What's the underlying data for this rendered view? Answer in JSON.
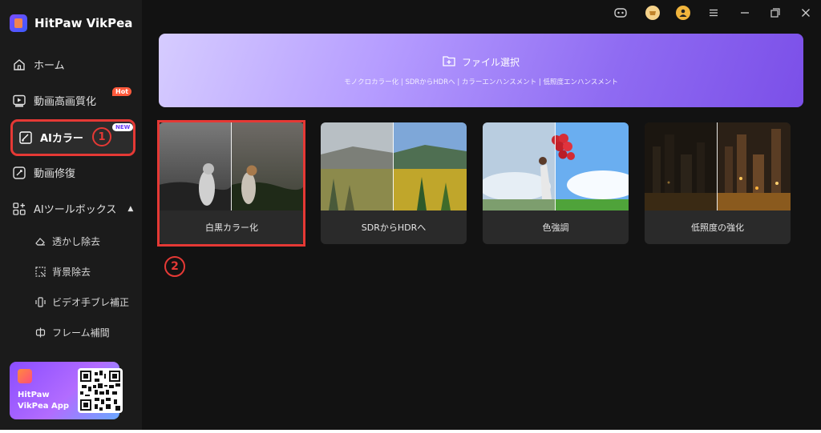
{
  "app": {
    "name": "HitPaw VikPea"
  },
  "sidebar": {
    "items": [
      {
        "label": "ホーム",
        "icon": "home-icon"
      },
      {
        "label": "動画高画質化",
        "icon": "video-enhance-icon",
        "badge": "Hot"
      },
      {
        "label": "AIカラー",
        "icon": "ai-color-icon",
        "badge": "NEW",
        "active": true
      },
      {
        "label": "動画修復",
        "icon": "repair-icon"
      },
      {
        "label": "AIツールボックス",
        "icon": "toolbox-icon"
      }
    ],
    "subitems": [
      {
        "label": "透かし除去",
        "icon": "eraser-icon"
      },
      {
        "label": "背景除去",
        "icon": "background-remove-icon"
      },
      {
        "label": "ビデオ手ブレ補正",
        "icon": "stabilize-icon"
      },
      {
        "label": "フレーム補間",
        "icon": "frame-interpolation-icon"
      }
    ],
    "app_card": {
      "line1": "HitPaw",
      "line2": "VikPea App"
    }
  },
  "annotations": {
    "step1": "1",
    "step2": "2"
  },
  "banner": {
    "title": "ファイル選択",
    "subtitle": "モノクロカラー化 | SDRからHDRへ | カラーエンハンスメント | 低照度エンハンスメント"
  },
  "cards": [
    {
      "label": "白黒カラー化"
    },
    {
      "label": "SDRからHDRへ"
    },
    {
      "label": "色強調"
    },
    {
      "label": "低照度の強化"
    }
  ],
  "colors": {
    "highlight": "#e53935",
    "accent": "#7b4fe8",
    "background": "#121212"
  }
}
